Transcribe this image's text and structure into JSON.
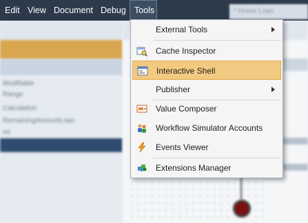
{
  "menubar": {
    "items": [
      "Edit",
      "View",
      "Document",
      "Debug",
      "Tools"
    ],
    "active": "Tools"
  },
  "document_tab": "* Home Loan Calculation",
  "background_list": [
    "Modifiable",
    "Range",
    "Calculation",
    "RemainingAmountLoan",
    "ml"
  ],
  "tools_menu": {
    "items": [
      {
        "label": "External Tools",
        "icon": "none",
        "submenu": true
      },
      {
        "label": "Cache Inspector",
        "icon": "cache-inspector-icon",
        "submenu": false
      },
      {
        "label": "Interactive Shell",
        "icon": "shell-window-icon",
        "submenu": false,
        "highlighted": true
      },
      {
        "label": "Publisher",
        "icon": "none",
        "submenu": true
      },
      {
        "label": "Value Composer",
        "icon": "value-composer-icon",
        "submenu": false
      },
      {
        "label": "Workflow Simulator Accounts",
        "icon": "users-icon",
        "submenu": false
      },
      {
        "label": "Events Viewer",
        "icon": "lightning-icon",
        "submenu": false
      },
      {
        "label": "Extensions Manager",
        "icon": "puzzle-icon",
        "submenu": false
      }
    ]
  },
  "colors": {
    "menubar_bg": "#2c3a4c",
    "highlight": "#f2c980",
    "header_accent": "#d7a64e",
    "selected_row": "#2f4b6f"
  }
}
